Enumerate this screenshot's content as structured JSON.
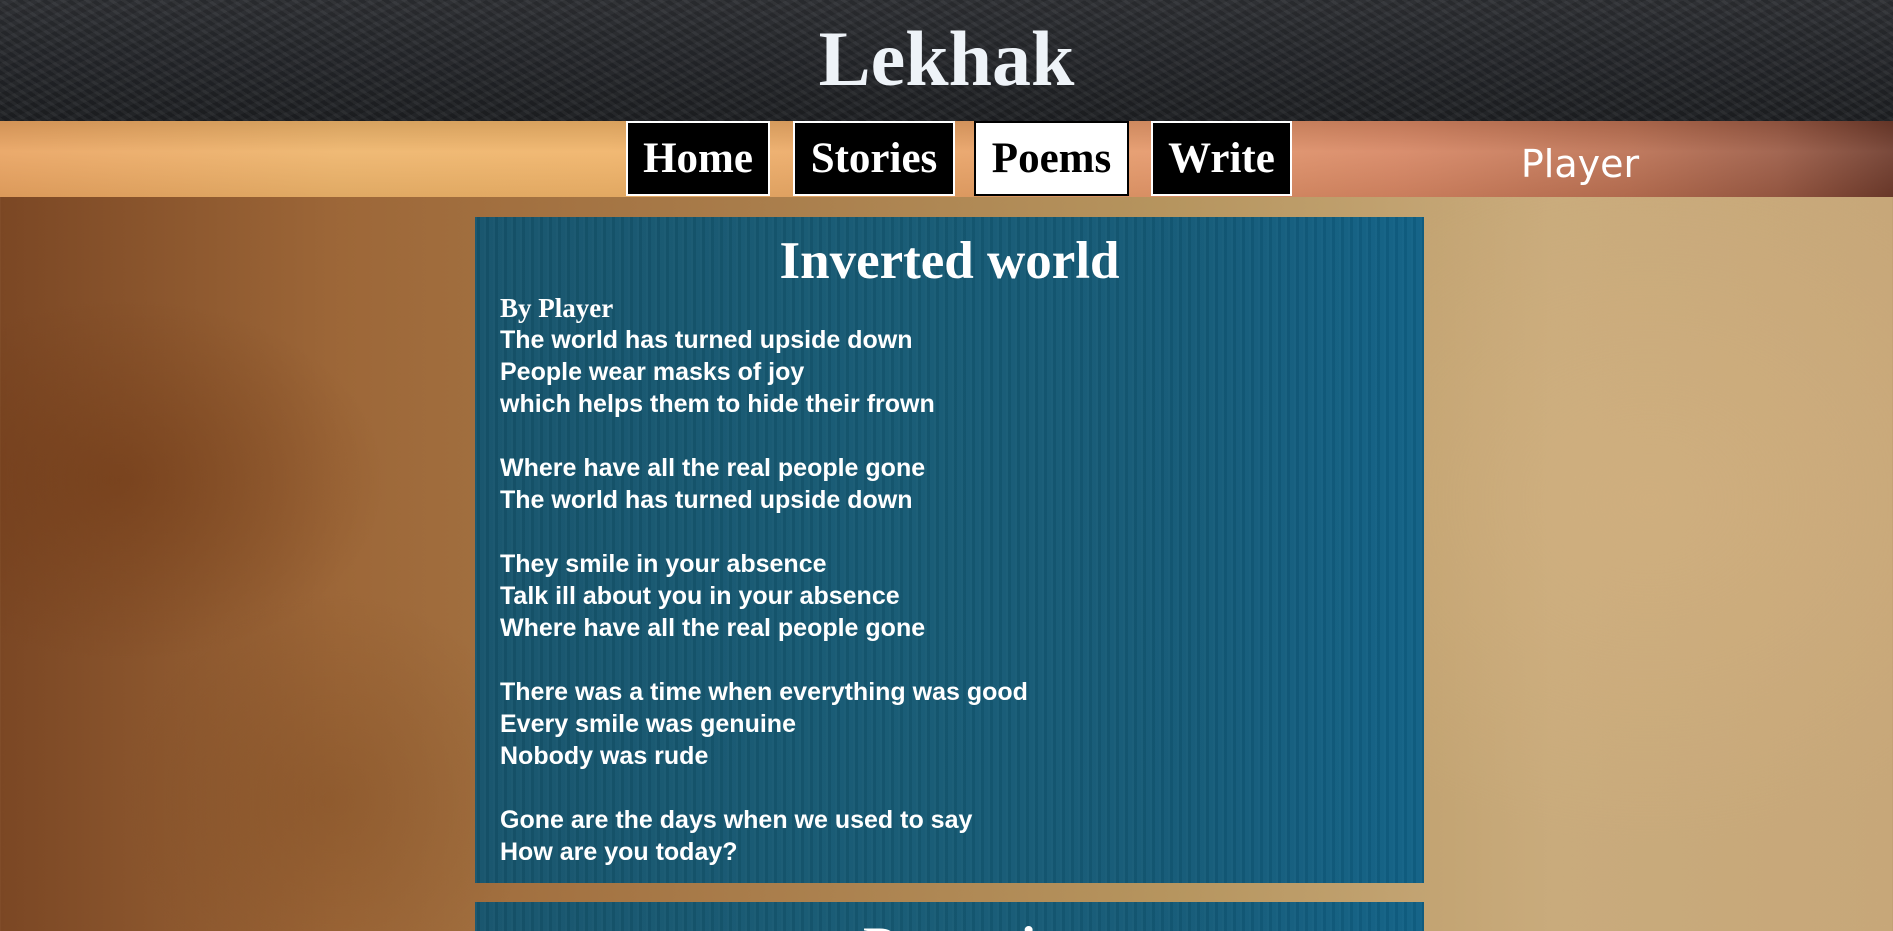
{
  "site": {
    "title": "Lekhak"
  },
  "nav": {
    "items": [
      {
        "label": "Home"
      },
      {
        "label": "Stories"
      },
      {
        "label": "Poems"
      },
      {
        "label": "Write"
      }
    ],
    "active": "Poems",
    "user": "Player"
  },
  "poems": [
    {
      "title": "Inverted world",
      "author": "By Player",
      "stanzas": [
        [
          "The world has turned upside down",
          "People wear masks of joy",
          "which helps them to hide their frown"
        ],
        [
          "Where have all the real people gone",
          "The world has turned upside down"
        ],
        [
          "They smile in your absence",
          "Talk ill about you in your absence",
          "Where have all the real people gone"
        ],
        [
          "There was a time when everything was good",
          "Every smile was genuine",
          "Nobody was rude"
        ],
        [
          "Gone are the days when we used to say",
          "How are you today?"
        ]
      ]
    },
    {
      "title": "Pareeni"
    }
  ],
  "colors": {
    "header_bg": "#25272b",
    "nav_button_bg": "#000000",
    "nav_button_active_bg": "#ffffff",
    "card_bg": "#165a74",
    "text": "#ffffff"
  }
}
